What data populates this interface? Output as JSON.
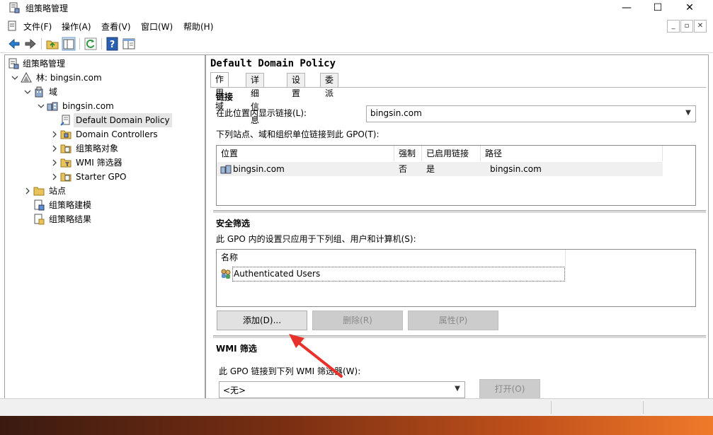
{
  "window": {
    "title": "组策略管理",
    "minimize": "—",
    "maximize": "☐",
    "close": "✕"
  },
  "menu": {
    "items": [
      "文件(F)",
      "操作(A)",
      "查看(V)",
      "窗口(W)",
      "帮助(H)"
    ],
    "mdi": [
      "_",
      "▫",
      "✕"
    ]
  },
  "toolbar": {
    "buttons": [
      "back-arrow-icon",
      "forward-arrow-icon",
      "folder-up-icon",
      "show-hide-tree-icon",
      "refresh-icon",
      "help-icon",
      "properties-pane-icon"
    ]
  },
  "tree": {
    "root": "组策略管理",
    "forest": "林: bingsin.com",
    "domains": "域",
    "domain": "bingsin.com",
    "children": [
      "Default Domain Policy",
      "Domain Controllers",
      "组策略对象",
      "WMI 筛选器",
      "Starter GPO"
    ],
    "sites": "站点",
    "modeling": "组策略建模",
    "results": "组策略结果"
  },
  "details": {
    "gpo_title": "Default Domain Policy",
    "tabs": [
      "作用域",
      "详细信息",
      "设置",
      "委派"
    ],
    "links": {
      "title": "链接",
      "show_links_label": "在此位置内显示链接(L):",
      "location_value": "bingsin.com",
      "linked_label": "下列站点、域和组织单位链接到此 GPO(T):",
      "columns": [
        "位置",
        "强制",
        "已启用链接",
        "路径"
      ],
      "rows": [
        {
          "location": "bingsin.com",
          "enforced": "否",
          "enabled": "是",
          "path": "bingsin.com"
        }
      ]
    },
    "security": {
      "title": "安全筛选",
      "desc": "此 GPO 内的设置只应用于下列组、用户和计算机(S):",
      "column": "名称",
      "rows": [
        "Authenticated Users"
      ],
      "add": "添加(D)...",
      "remove": "删除(R)",
      "properties": "属性(P)"
    },
    "wmi": {
      "title": "WMI 筛选",
      "desc": "此 GPO 链接到下列 WMI 筛选器(W):",
      "value": "<无>",
      "open": "打开(O)"
    }
  },
  "colors": {
    "annotation_arrow": "#e8312a",
    "selection": "#e5e5e5"
  }
}
